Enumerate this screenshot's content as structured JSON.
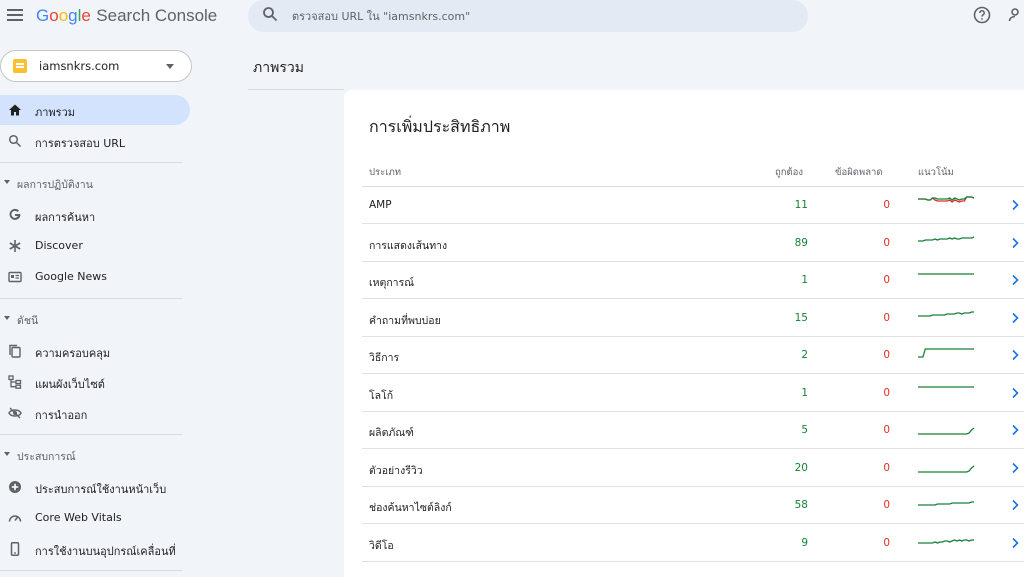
{
  "header": {
    "logo_letters": [
      {
        "ch": "G",
        "color": "#4285f4"
      },
      {
        "ch": "o",
        "color": "#ea4335"
      },
      {
        "ch": "o",
        "color": "#fbbc05"
      },
      {
        "ch": "g",
        "color": "#4285f4"
      },
      {
        "ch": "l",
        "color": "#34a853"
      },
      {
        "ch": "e",
        "color": "#ea4335"
      }
    ],
    "product": "Search Console",
    "search_placeholder": "ตรวจสอบ URL ใน \"iamsnkrs.com\""
  },
  "sidebar": {
    "property": "iamsnkrs.com",
    "items": [
      {
        "label": "ภาพรวม",
        "icon": "home-icon",
        "active": true
      },
      {
        "label": "การตรวจสอบ URL",
        "icon": "search-icon"
      }
    ],
    "sections": [
      {
        "label": "ผลการปฏิบัติงาน",
        "items": [
          {
            "label": "ผลการค้นหา",
            "icon": "google-g-icon"
          },
          {
            "label": "Discover",
            "icon": "asterisk-icon"
          },
          {
            "label": "Google News",
            "icon": "news-icon"
          }
        ]
      },
      {
        "label": "ดัชนี",
        "items": [
          {
            "label": "ความครอบคลุม",
            "icon": "copy-icon"
          },
          {
            "label": "แผนผังเว็บไซต์",
            "icon": "sitemap-icon"
          },
          {
            "label": "การนำออก",
            "icon": "eye-off-icon"
          }
        ]
      },
      {
        "label": "ประสบการณ์",
        "items": [
          {
            "label": "ประสบการณ์ใช้งานหน้าเว็บ",
            "icon": "plus-circle-icon"
          },
          {
            "label": "Core Web Vitals",
            "icon": "gauge-icon"
          },
          {
            "label": "การใช้งานบนอุปกรณ์เคลื่อนที่",
            "icon": "phone-icon"
          }
        ]
      }
    ]
  },
  "main": {
    "page_title": "ภาพรวม",
    "card": {
      "title": "การเพิ่มประสิทธิภาพ",
      "columns": {
        "type": "ประเภท",
        "valid": "ถูกต้อง",
        "error": "ข้อผิดพลาด",
        "trend": "แนวโน้ม"
      },
      "rows": [
        {
          "label": "AMP",
          "valid": "11",
          "error": "0",
          "trend": [
            6,
            6,
            6,
            6,
            7,
            7,
            5,
            5,
            6,
            6,
            6,
            6,
            6,
            5,
            7,
            5,
            6,
            7,
            6,
            6,
            4,
            4,
            4,
            5
          ]
        },
        {
          "label": "การแสดงเส้นทาง",
          "valid": "89",
          "error": "0",
          "trend": [
            10,
            10,
            10,
            9,
            9,
            9,
            9,
            8,
            9,
            8,
            8,
            8,
            8,
            7,
            8,
            7,
            8,
            8,
            7,
            7,
            7,
            7,
            7,
            6
          ]
        },
        {
          "label": "เหตุการณ์",
          "valid": "1",
          "error": "0",
          "trend": [
            6,
            6,
            6,
            6,
            6,
            6,
            6,
            6,
            6,
            6,
            6,
            6,
            6,
            6,
            6,
            6,
            6,
            6,
            6,
            6,
            6,
            6,
            6,
            6
          ]
        },
        {
          "label": "คำถามที่พบบ่อย",
          "valid": "15",
          "error": "0",
          "trend": [
            10,
            10,
            10,
            10,
            10,
            10,
            9,
            9,
            9,
            9,
            9,
            9,
            8,
            8,
            8,
            8,
            7,
            7,
            8,
            7,
            7,
            7,
            6,
            6
          ]
        },
        {
          "label": "วิธีการ",
          "valid": "2",
          "error": "0",
          "trend": [
            14,
            14,
            14,
            6,
            6,
            6,
            6,
            6,
            6,
            6,
            6,
            6,
            6,
            6,
            6,
            6,
            6,
            6,
            6,
            6,
            6,
            6,
            6,
            6
          ]
        },
        {
          "label": "โลโก้",
          "valid": "1",
          "error": "0",
          "trend": [
            6,
            6,
            6,
            6,
            6,
            6,
            6,
            6,
            6,
            6,
            6,
            6,
            6,
            6,
            6,
            6,
            6,
            6,
            6,
            6,
            6,
            6,
            6,
            6
          ]
        },
        {
          "label": "ผลิตภัณฑ์",
          "valid": "5",
          "error": "0",
          "trend": [
            16,
            16,
            16,
            16,
            16,
            16,
            16,
            16,
            16,
            16,
            16,
            16,
            16,
            16,
            16,
            16,
            16,
            16,
            16,
            16,
            16,
            15,
            12,
            10
          ]
        },
        {
          "label": "ตัวอย่างรีวิว",
          "valid": "20",
          "error": "0",
          "trend": [
            16,
            16,
            16,
            16,
            16,
            16,
            16,
            16,
            16,
            16,
            16,
            16,
            16,
            16,
            16,
            16,
            16,
            16,
            16,
            16,
            16,
            15,
            12,
            10
          ]
        },
        {
          "label": "ช่องค้นหาไซต์ลิงก์",
          "valid": "58",
          "error": "0",
          "trend": [
            12,
            12,
            12,
            12,
            12,
            12,
            12,
            12,
            11,
            11,
            11,
            11,
            11,
            11,
            10,
            10,
            10,
            10,
            10,
            10,
            10,
            10,
            9,
            9
          ]
        },
        {
          "label": "วิดีโอ",
          "valid": "9",
          "error": "0",
          "trend": [
            12,
            12,
            12,
            12,
            12,
            12,
            12,
            11,
            12,
            11,
            11,
            10,
            10,
            11,
            10,
            9,
            10,
            9,
            10,
            9,
            9,
            10,
            9,
            9
          ]
        }
      ]
    }
  },
  "colors": {
    "accent": "#1a73e8",
    "valid": "#188038",
    "error": "#d93025",
    "trend": "#188038",
    "trend_error": "#d93025",
    "active_bg": "#d3e3fd"
  }
}
